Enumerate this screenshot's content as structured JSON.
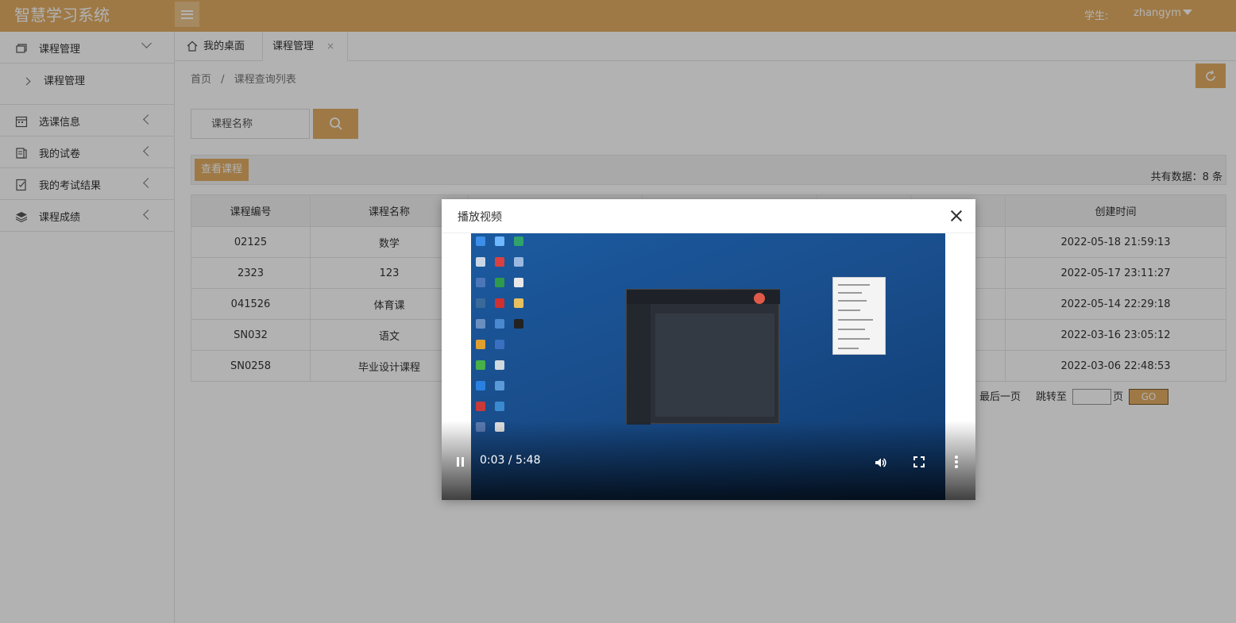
{
  "app": {
    "title": "智慧学习系统"
  },
  "user": {
    "role_label": "学生:",
    "name": "zhangym"
  },
  "sidebar": {
    "items": [
      {
        "label": "课程管理",
        "expanded": true,
        "icon": "course-icon"
      },
      {
        "label": "课程管理",
        "sub": true
      },
      {
        "label": "选课信息",
        "icon": "calendar-icon"
      },
      {
        "label": "我的试卷",
        "icon": "paper-icon"
      },
      {
        "label": "我的考试结果",
        "icon": "exam-icon"
      },
      {
        "label": "课程成绩",
        "icon": "layers-icon"
      }
    ]
  },
  "tabs": {
    "home": "我的桌面",
    "course": "课程管理",
    "close": "×"
  },
  "breadcrumb": {
    "home": "首页",
    "sep": "/",
    "current": "课程查询列表"
  },
  "search": {
    "placeholder": "课程名称"
  },
  "toolbar": {
    "view_label": "查看课程",
    "total_label": "共有数据：8 条"
  },
  "table": {
    "headers": [
      "课程编号",
      "课程名称",
      "",
      "",
      "",
      "",
      "创建时间"
    ],
    "rows": [
      {
        "code": "02125",
        "name": "数学",
        "created": "2022-05-18 21:59:13"
      },
      {
        "code": "2323",
        "name": "123",
        "created": "2022-05-17 23:11:27"
      },
      {
        "code": "041526",
        "name": "体育课",
        "created": "2022-05-14 22:29:18"
      },
      {
        "code": "SN032",
        "name": "语文",
        "created": "2022-03-16 23:05:12"
      },
      {
        "code": "SN0258",
        "name": "毕业设计课程",
        "created": "2022-03-06 22:48:53"
      }
    ]
  },
  "pager": {
    "last": "最后一页",
    "jump": "跳转至",
    "page": "页",
    "go": "GO"
  },
  "modal": {
    "title": "播放视频",
    "video": {
      "time": "0:03 / 5:48",
      "progress": 0.009
    }
  },
  "colors": {
    "accent": "#e2ae65",
    "accent_light": "#edc48a"
  }
}
